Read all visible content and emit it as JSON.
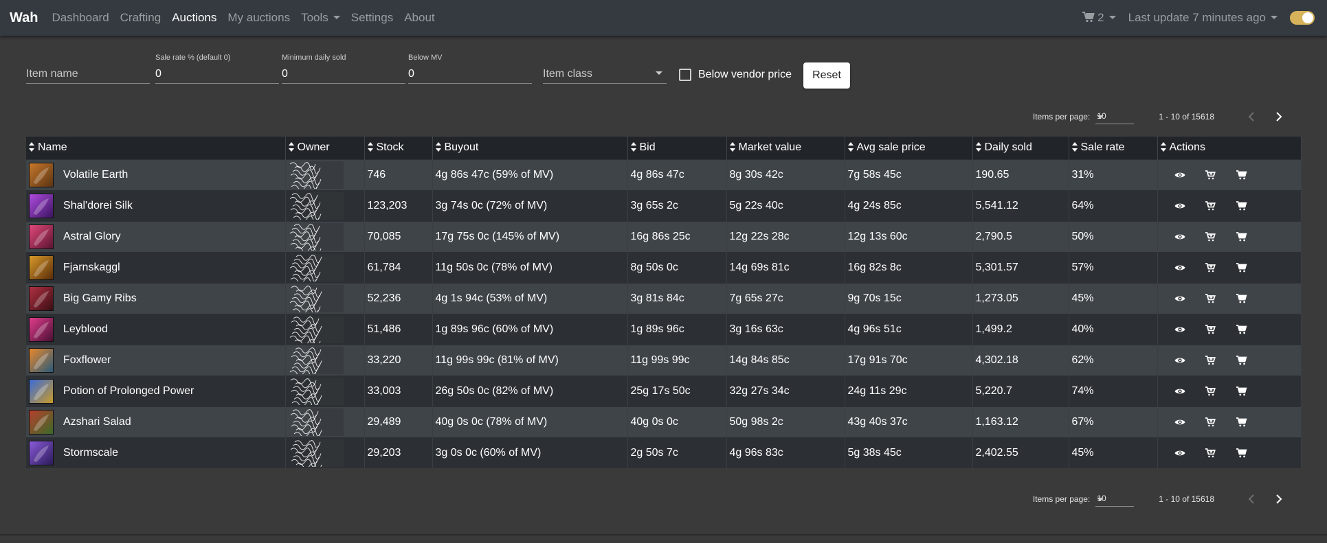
{
  "navbar": {
    "brand": "Wah",
    "links": [
      {
        "label": "Dashboard",
        "active": false
      },
      {
        "label": "Crafting",
        "active": false
      },
      {
        "label": "Auctions",
        "active": true
      },
      {
        "label": "My auctions",
        "active": false
      },
      {
        "label": "Tools",
        "active": false,
        "dropdown": true
      },
      {
        "label": "Settings",
        "active": false
      },
      {
        "label": "About",
        "active": false
      }
    ],
    "cart_count": "2",
    "last_update": "Last update 7 minutes ago",
    "toggle_color": "#d6b35a"
  },
  "filters": {
    "item_name_placeholder": "Item name",
    "sale_rate_label": "Sale rate % (default 0)",
    "sale_rate_value": "0",
    "min_daily_sold_label": "Minimum daily sold",
    "min_daily_sold_value": "0",
    "below_mv_label": "Below MV",
    "below_mv_value": "0",
    "item_class_placeholder": "Item class",
    "below_vendor_label": "Below vendor price",
    "reset_label": "Reset"
  },
  "paginator": {
    "items_per_page_label": "Items per page:",
    "items_per_page_value": "10",
    "range": "1 - 10 of 15618"
  },
  "table": {
    "headers": [
      "Name",
      "Owner",
      "Stock",
      "Buyout",
      "Bid",
      "Market value",
      "Avg sale price",
      "Daily sold",
      "Sale rate",
      "Actions"
    ],
    "rows": [
      {
        "name": "Volatile Earth",
        "stock": "746",
        "buyout": "4g 86s 47c (59% of MV)",
        "bid": "4g 86s 47c",
        "market_value": "8g 30s 42c",
        "avg_sale_price": "7g 58s 45c",
        "daily_sold": "190.65",
        "sale_rate": "31%",
        "icon_colors": [
          "#c8782c",
          "#5a3412"
        ]
      },
      {
        "name": "Shal'dorei Silk",
        "stock": "123,203",
        "buyout": "3g 74s 0c (72% of MV)",
        "bid": "3g 65s 2c",
        "market_value": "5g 22s 40c",
        "avg_sale_price": "4g 24s 85c",
        "daily_sold": "5,541.12",
        "sale_rate": "64%",
        "icon_colors": [
          "#b14ce0",
          "#3a1460"
        ]
      },
      {
        "name": "Astral Glory",
        "stock": "70,085",
        "buyout": "17g 75s 0c (145% of MV)",
        "bid": "16g 86s 25c",
        "market_value": "12g 22s 28c",
        "avg_sale_price": "12g 13s 60c",
        "daily_sold": "2,790.5",
        "sale_rate": "50%",
        "icon_colors": [
          "#e2487a",
          "#5a1430"
        ]
      },
      {
        "name": "Fjarnskaggl",
        "stock": "61,784",
        "buyout": "11g 50s 0c (78% of MV)",
        "bid": "8g 50s 0c",
        "market_value": "14g 69s 81c",
        "avg_sale_price": "16g 82s 8c",
        "daily_sold": "5,301.57",
        "sale_rate": "57%",
        "icon_colors": [
          "#d89a2a",
          "#5a2c0a"
        ]
      },
      {
        "name": "Big Gamy Ribs",
        "stock": "52,236",
        "buyout": "4g 1s 94c (53% of MV)",
        "bid": "3g 81s 84c",
        "market_value": "7g 65s 27c",
        "avg_sale_price": "9g 70s 15c",
        "daily_sold": "1,273.05",
        "sale_rate": "45%",
        "icon_colors": [
          "#b03040",
          "#3a0e14"
        ]
      },
      {
        "name": "Leyblood",
        "stock": "51,486",
        "buyout": "1g 89s 96c (60% of MV)",
        "bid": "1g 89s 96c",
        "market_value": "3g 16s 63c",
        "avg_sale_price": "4g 96s 51c",
        "daily_sold": "1,499.2",
        "sale_rate": "40%",
        "icon_colors": [
          "#e03c8c",
          "#4a1034"
        ]
      },
      {
        "name": "Foxflower",
        "stock": "33,220",
        "buyout": "11g 99s 99c (81% of MV)",
        "bid": "11g 99s 99c",
        "market_value": "14g 84s 85c",
        "avg_sale_price": "17g 91s 70c",
        "daily_sold": "4,302.18",
        "sale_rate": "62%",
        "icon_colors": [
          "#e8882c",
          "#2a5a7a"
        ]
      },
      {
        "name": "Potion of Prolonged Power",
        "stock": "33,003",
        "buyout": "26g 50s 0c (82% of MV)",
        "bid": "25g 17s 50c",
        "market_value": "32g 27s 34c",
        "avg_sale_price": "24g 11s 29c",
        "daily_sold": "5,220.7",
        "sale_rate": "74%",
        "icon_colors": [
          "#3c6cd8",
          "#c89a2a"
        ]
      },
      {
        "name": "Azshari Salad",
        "stock": "29,489",
        "buyout": "40g 0s 0c (78% of MV)",
        "bid": "40g 0s 0c",
        "market_value": "50g 98s 2c",
        "avg_sale_price": "43g 40s 37c",
        "daily_sold": "1,163.12",
        "sale_rate": "67%",
        "icon_colors": [
          "#b8402c",
          "#3a6a2a"
        ]
      },
      {
        "name": "Stormscale",
        "stock": "29,203",
        "buyout": "3g 0s 0c (60% of MV)",
        "bid": "2g 50s 7c",
        "market_value": "4g 96s 83c",
        "avg_sale_price": "5g 38s 45c",
        "daily_sold": "2,402.55",
        "sale_rate": "45%",
        "icon_colors": [
          "#8a5ad8",
          "#2a1a5a"
        ]
      }
    ],
    "actions": [
      "eye-icon",
      "cart-add-icon",
      "cart-icon"
    ]
  }
}
